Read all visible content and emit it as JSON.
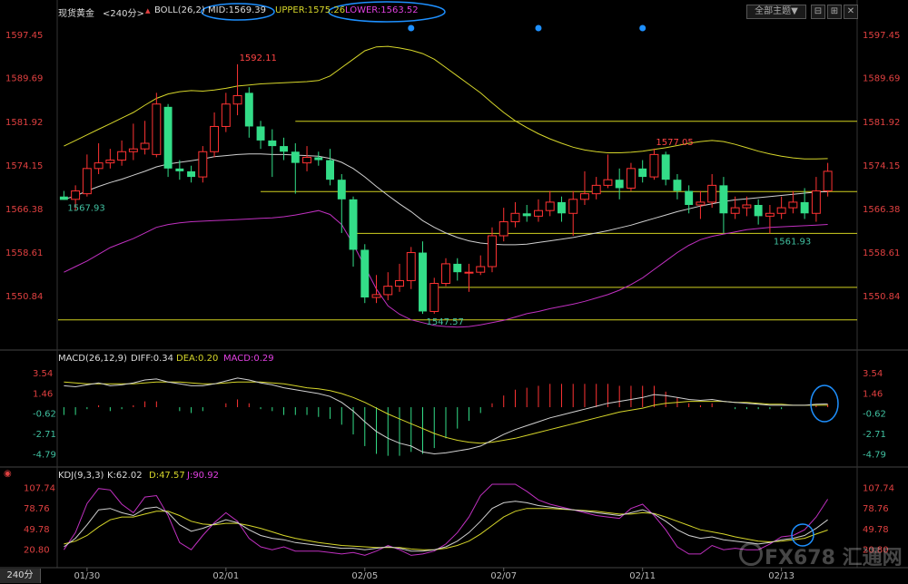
{
  "header": {
    "symbol": "现货黄金",
    "period": "<240分>",
    "boll": "BOLL(26,2)",
    "mid": "MID:1569.39",
    "upper": "UPPER:1575.26",
    "lower": "LOWER:1563.52",
    "theme_menu": "全部主题▼"
  },
  "macd_header": {
    "name": "MACD(26,12,9)",
    "diff": "DIFF:0.34",
    "dea": "DEA:0.20",
    "macd": "MACD:0.29"
  },
  "kdj_header": {
    "name": "KDJ(9,3,3)",
    "k": "K:62.02",
    "d": "D:47.57",
    "j": "J:90.92"
  },
  "period_tab": "240分",
  "watermark": "FX678 汇通网",
  "colors": {
    "up": "#ff3333",
    "down": "#33dd88",
    "mid": "#d0d0d0",
    "upper": "#d6d62a",
    "lower": "#c030c0",
    "hline": "#d0d020",
    "diff": "#d0d0d0",
    "dea": "#d6d62a",
    "j": "#c030c0",
    "axis_red": "#e04040",
    "axis_teal": "#40c0a0",
    "marker": "#1e90ff",
    "circle": "#1e90ff"
  },
  "chart_data": [
    {
      "type": "candlestick",
      "title": "现货黄金 240分",
      "ylim": [
        1545,
        1600
      ],
      "y_ticks": [
        1597.45,
        1589.69,
        1581.92,
        1574.15,
        1566.38,
        1558.61,
        1550.84
      ],
      "x_labels": [
        "01/30",
        "02/01",
        "02/05",
        "02/07",
        "02/11",
        "02/13"
      ],
      "x_label_index": [
        2,
        14,
        26,
        38,
        50,
        62
      ],
      "candles": [
        {
          "o": 1568.5,
          "c": 1567.9,
          "h": 1569.5,
          "l": 1567.9
        },
        {
          "o": 1568.0,
          "c": 1569.5,
          "h": 1570.5,
          "l": 1566.0
        },
        {
          "o": 1569.0,
          "c": 1573.5,
          "h": 1576.0,
          "l": 1568.5
        },
        {
          "o": 1573.5,
          "c": 1574.5,
          "h": 1578.0,
          "l": 1572.5
        },
        {
          "o": 1574.5,
          "c": 1575.0,
          "h": 1577.0,
          "l": 1573.5
        },
        {
          "o": 1575.0,
          "c": 1576.5,
          "h": 1578.5,
          "l": 1574.0
        },
        {
          "o": 1576.5,
          "c": 1577.0,
          "h": 1581.5,
          "l": 1575.0
        },
        {
          "o": 1577.0,
          "c": 1578.0,
          "h": 1582.0,
          "l": 1576.0
        },
        {
          "o": 1576.0,
          "c": 1585.0,
          "h": 1587.0,
          "l": 1575.5
        },
        {
          "o": 1584.5,
          "c": 1573.5,
          "h": 1585.0,
          "l": 1572.0
        },
        {
          "o": 1573.5,
          "c": 1573.0,
          "h": 1575.0,
          "l": 1571.5
        },
        {
          "o": 1573.0,
          "c": 1572.0,
          "h": 1574.0,
          "l": 1571.0
        },
        {
          "o": 1572.0,
          "c": 1576.5,
          "h": 1577.5,
          "l": 1571.0
        },
        {
          "o": 1576.5,
          "c": 1581.0,
          "h": 1583.5,
          "l": 1575.5
        },
        {
          "o": 1581.0,
          "c": 1585.0,
          "h": 1587.0,
          "l": 1580.0
        },
        {
          "o": 1585.0,
          "c": 1586.5,
          "h": 1592.1,
          "l": 1583.0
        },
        {
          "o": 1587.0,
          "c": 1581.0,
          "h": 1588.0,
          "l": 1579.0
        },
        {
          "o": 1581.0,
          "c": 1578.5,
          "h": 1582.0,
          "l": 1577.0
        },
        {
          "o": 1578.5,
          "c": 1577.5,
          "h": 1580.5,
          "l": 1572.0
        },
        {
          "o": 1577.5,
          "c": 1576.5,
          "h": 1579.0,
          "l": 1575.0
        },
        {
          "o": 1576.5,
          "c": 1574.5,
          "h": 1578.0,
          "l": 1569.0
        },
        {
          "o": 1574.5,
          "c": 1575.5,
          "h": 1577.5,
          "l": 1573.0
        },
        {
          "o": 1575.5,
          "c": 1575.0,
          "h": 1576.5,
          "l": 1574.0
        },
        {
          "o": 1575.0,
          "c": 1571.5,
          "h": 1577.0,
          "l": 1570.5
        },
        {
          "o": 1571.5,
          "c": 1568.0,
          "h": 1572.5,
          "l": 1562.0
        },
        {
          "o": 1568.0,
          "c": 1559.0,
          "h": 1568.5,
          "l": 1556.0
        },
        {
          "o": 1559.0,
          "c": 1550.5,
          "h": 1560.0,
          "l": 1549.5
        },
        {
          "o": 1550.5,
          "c": 1551.0,
          "h": 1554.5,
          "l": 1549.5
        },
        {
          "o": 1551.0,
          "c": 1552.5,
          "h": 1555.0,
          "l": 1550.0
        },
        {
          "o": 1552.5,
          "c": 1553.5,
          "h": 1556.5,
          "l": 1551.5
        },
        {
          "o": 1553.5,
          "c": 1558.5,
          "h": 1559.5,
          "l": 1552.0
        },
        {
          "o": 1558.5,
          "c": 1548.0,
          "h": 1560.5,
          "l": 1547.57
        },
        {
          "o": 1548.0,
          "c": 1553.0,
          "h": 1554.0,
          "l": 1547.6
        },
        {
          "o": 1553.0,
          "c": 1556.5,
          "h": 1557.5,
          "l": 1552.5
        },
        {
          "o": 1556.5,
          "c": 1555.0,
          "h": 1557.5,
          "l": 1553.5
        },
        {
          "o": 1555.0,
          "c": 1555.0,
          "h": 1556.5,
          "l": 1551.5
        },
        {
          "o": 1555.0,
          "c": 1556.0,
          "h": 1558.0,
          "l": 1554.5
        },
        {
          "o": 1556.0,
          "c": 1561.5,
          "h": 1563.0,
          "l": 1555.0
        },
        {
          "o": 1561.5,
          "c": 1564.0,
          "h": 1566.5,
          "l": 1560.5
        },
        {
          "o": 1564.0,
          "c": 1565.5,
          "h": 1567.5,
          "l": 1563.0
        },
        {
          "o": 1565.5,
          "c": 1565.0,
          "h": 1567.0,
          "l": 1564.0
        },
        {
          "o": 1565.0,
          "c": 1566.0,
          "h": 1568.0,
          "l": 1564.0
        },
        {
          "o": 1566.0,
          "c": 1567.5,
          "h": 1569.5,
          "l": 1565.0
        },
        {
          "o": 1567.5,
          "c": 1565.5,
          "h": 1568.5,
          "l": 1564.0
        },
        {
          "o": 1565.5,
          "c": 1568.0,
          "h": 1569.5,
          "l": 1561.5
        },
        {
          "o": 1568.0,
          "c": 1569.0,
          "h": 1573.0,
          "l": 1567.0
        },
        {
          "o": 1569.0,
          "c": 1570.5,
          "h": 1572.0,
          "l": 1568.0
        },
        {
          "o": 1570.5,
          "c": 1571.5,
          "h": 1576.0,
          "l": 1570.0
        },
        {
          "o": 1571.5,
          "c": 1570.0,
          "h": 1573.5,
          "l": 1568.0
        },
        {
          "o": 1570.0,
          "c": 1573.5,
          "h": 1574.5,
          "l": 1569.5
        },
        {
          "o": 1573.5,
          "c": 1572.0,
          "h": 1575.0,
          "l": 1571.0
        },
        {
          "o": 1572.0,
          "c": 1576.0,
          "h": 1577.05,
          "l": 1571.5
        },
        {
          "o": 1576.0,
          "c": 1571.5,
          "h": 1576.5,
          "l": 1570.5
        },
        {
          "o": 1571.5,
          "c": 1569.5,
          "h": 1572.5,
          "l": 1568.0
        },
        {
          "o": 1569.5,
          "c": 1567.0,
          "h": 1570.5,
          "l": 1565.5
        },
        {
          "o": 1567.0,
          "c": 1567.5,
          "h": 1569.5,
          "l": 1564.5
        },
        {
          "o": 1567.5,
          "c": 1570.5,
          "h": 1572.5,
          "l": 1566.5
        },
        {
          "o": 1570.5,
          "c": 1565.5,
          "h": 1572.0,
          "l": 1562.0
        },
        {
          "o": 1565.5,
          "c": 1566.5,
          "h": 1568.5,
          "l": 1564.5
        },
        {
          "o": 1566.5,
          "c": 1567.0,
          "h": 1568.5,
          "l": 1565.0
        },
        {
          "o": 1567.0,
          "c": 1565.0,
          "h": 1568.0,
          "l": 1563.5
        },
        {
          "o": 1565.0,
          "c": 1565.5,
          "h": 1567.0,
          "l": 1561.93
        },
        {
          "o": 1565.5,
          "c": 1566.5,
          "h": 1568.5,
          "l": 1564.5
        },
        {
          "o": 1566.5,
          "c": 1567.5,
          "h": 1569.5,
          "l": 1565.5
        },
        {
          "o": 1567.5,
          "c": 1565.5,
          "h": 1570.0,
          "l": 1564.5
        },
        {
          "o": 1565.5,
          "c": 1569.5,
          "h": 1572.0,
          "l": 1564.0
        },
        {
          "o": 1569.5,
          "c": 1573.0,
          "h": 1574.5,
          "l": 1568.5
        }
      ],
      "mid": [
        1568.0,
        1568.6,
        1569.5,
        1570.3,
        1571.0,
        1571.6,
        1572.3,
        1573.0,
        1573.8,
        1574.3,
        1574.6,
        1574.9,
        1575.2,
        1575.6,
        1575.8,
        1576.0,
        1576.1,
        1576.1,
        1576.0,
        1576.0,
        1575.9,
        1575.8,
        1575.7,
        1575.3,
        1574.6,
        1573.5,
        1572.0,
        1570.3,
        1568.7,
        1567.2,
        1565.8,
        1564.2,
        1563.0,
        1562.0,
        1561.2,
        1560.6,
        1560.2,
        1560.0,
        1559.9,
        1559.9,
        1560.0,
        1560.3,
        1560.6,
        1560.9,
        1561.2,
        1561.6,
        1562.0,
        1562.4,
        1562.9,
        1563.4,
        1564.0,
        1564.6,
        1565.2,
        1565.8,
        1566.3,
        1566.8,
        1567.2,
        1567.6,
        1567.9,
        1568.1,
        1568.3,
        1568.5,
        1568.7,
        1568.9,
        1569.1,
        1569.3,
        1569.39
      ],
      "upper": [
        1577.5,
        1578.5,
        1579.5,
        1580.5,
        1581.5,
        1582.5,
        1583.5,
        1584.8,
        1586.0,
        1586.8,
        1587.2,
        1587.4,
        1587.3,
        1587.5,
        1587.8,
        1588.2,
        1588.4,
        1588.6,
        1588.7,
        1588.8,
        1588.9,
        1589.0,
        1589.2,
        1590.0,
        1591.5,
        1593.0,
        1594.5,
        1595.2,
        1595.3,
        1595.0,
        1594.6,
        1594.0,
        1593.0,
        1591.5,
        1590.0,
        1588.5,
        1587.0,
        1585.2,
        1583.5,
        1582.0,
        1580.8,
        1579.7,
        1578.8,
        1578.0,
        1577.3,
        1576.8,
        1576.5,
        1576.3,
        1576.3,
        1576.4,
        1576.6,
        1576.9,
        1577.2,
        1577.6,
        1578.0,
        1578.3,
        1578.5,
        1578.3,
        1577.8,
        1577.2,
        1576.6,
        1576.1,
        1575.7,
        1575.4,
        1575.2,
        1575.2,
        1575.26
      ],
      "lower": [
        1555.0,
        1556.0,
        1557.0,
        1558.2,
        1559.4,
        1560.2,
        1561.0,
        1562.0,
        1563.0,
        1563.5,
        1563.8,
        1564.0,
        1564.1,
        1564.2,
        1564.3,
        1564.4,
        1564.5,
        1564.6,
        1564.7,
        1564.9,
        1565.2,
        1565.6,
        1566.0,
        1565.3,
        1563.5,
        1560.0,
        1556.0,
        1552.0,
        1549.0,
        1547.5,
        1546.5,
        1546.0,
        1545.5,
        1545.3,
        1545.2,
        1545.3,
        1545.6,
        1546.0,
        1546.4,
        1547.0,
        1547.6,
        1548.0,
        1548.5,
        1548.9,
        1549.3,
        1549.8,
        1550.4,
        1551.0,
        1551.8,
        1552.8,
        1554.0,
        1555.5,
        1557.0,
        1558.5,
        1559.8,
        1560.8,
        1561.4,
        1561.8,
        1562.2,
        1562.6,
        1562.8,
        1563.0,
        1563.1,
        1563.2,
        1563.3,
        1563.4,
        1563.52
      ],
      "hlines": [
        {
          "y": 1581.92,
          "x0": 20,
          "x1": 66
        },
        {
          "y": 1569.39,
          "x0": 17,
          "x1": 66
        },
        {
          "y": 1561.93,
          "x0": 25,
          "x1": 66
        },
        {
          "y": 1552.3,
          "x0": 32,
          "x1": 66
        },
        {
          "y": 1546.5,
          "x0": 0,
          "x1": 66
        }
      ],
      "annotations": [
        {
          "text": "1592.11",
          "index": 15,
          "value": 1592.11,
          "color": "#ff4444"
        },
        {
          "text": "1567.93",
          "index": 0,
          "value": 1567.93,
          "color": "#40c0a0"
        },
        {
          "text": "1547.57",
          "index": 31,
          "value": 1547.57,
          "color": "#40c0a0"
        },
        {
          "text": "1577.05",
          "index": 51,
          "value": 1577.05,
          "color": "#ff4444"
        },
        {
          "text": "1561.93",
          "index": 61,
          "value": 1561.93,
          "color": "#40c0a0"
        }
      ],
      "markers_index": [
        30,
        41,
        50
      ]
    },
    {
      "type": "macd",
      "ylim": [
        -5.5,
        4.2
      ],
      "y_ticks": [
        3.54,
        1.46,
        -0.62,
        -2.71,
        -4.79
      ],
      "diff": [
        2.2,
        2.1,
        2.3,
        2.5,
        2.2,
        2.3,
        2.5,
        2.8,
        2.9,
        2.6,
        2.4,
        2.2,
        2.2,
        2.4,
        2.7,
        3.0,
        2.8,
        2.5,
        2.3,
        2.0,
        1.8,
        1.6,
        1.4,
        1.1,
        0.5,
        -0.4,
        -1.5,
        -2.5,
        -3.2,
        -3.7,
        -4.0,
        -4.6,
        -4.8,
        -4.7,
        -4.5,
        -4.3,
        -4.0,
        -3.4,
        -2.8,
        -2.3,
        -1.9,
        -1.5,
        -1.1,
        -0.8,
        -0.5,
        -0.2,
        0.1,
        0.4,
        0.6,
        0.8,
        1.0,
        1.3,
        1.2,
        1.0,
        0.8,
        0.7,
        0.8,
        0.6,
        0.5,
        0.4,
        0.3,
        0.2,
        0.2,
        0.2,
        0.2,
        0.3,
        0.34
      ],
      "dea": [
        2.6,
        2.5,
        2.4,
        2.4,
        2.4,
        2.4,
        2.4,
        2.5,
        2.6,
        2.6,
        2.6,
        2.5,
        2.4,
        2.4,
        2.5,
        2.6,
        2.6,
        2.6,
        2.5,
        2.4,
        2.2,
        2.0,
        1.9,
        1.7,
        1.4,
        1.0,
        0.5,
        -0.1,
        -0.7,
        -1.2,
        -1.7,
        -2.2,
        -2.7,
        -3.1,
        -3.4,
        -3.6,
        -3.7,
        -3.6,
        -3.4,
        -3.2,
        -2.9,
        -2.6,
        -2.3,
        -2.0,
        -1.7,
        -1.4,
        -1.1,
        -0.8,
        -0.5,
        -0.3,
        -0.1,
        0.2,
        0.4,
        0.5,
        0.6,
        0.6,
        0.6,
        0.6,
        0.5,
        0.5,
        0.4,
        0.3,
        0.3,
        0.2,
        0.2,
        0.2,
        0.2
      ],
      "hist": [
        -0.8,
        -0.8,
        -0.2,
        0.2,
        -0.4,
        -0.2,
        0.2,
        0.6,
        0.6,
        0.0,
        -0.4,
        -0.6,
        -0.4,
        0.0,
        0.4,
        0.8,
        0.4,
        -0.2,
        -0.4,
        -0.8,
        -0.8,
        -0.8,
        -1.0,
        -1.2,
        -1.8,
        -2.8,
        -4.0,
        -4.8,
        -5.0,
        -5.0,
        -4.6,
        -4.8,
        -4.2,
        -3.2,
        -2.2,
        -1.4,
        -0.6,
        0.4,
        1.2,
        1.8,
        2.0,
        2.2,
        2.4,
        2.4,
        2.4,
        2.4,
        2.4,
        2.4,
        2.2,
        2.2,
        2.2,
        2.2,
        1.6,
        1.0,
        0.4,
        0.2,
        0.4,
        0.0,
        -0.2,
        -0.2,
        -0.2,
        -0.2,
        -0.2,
        0.0,
        0.0,
        0.2,
        0.29
      ]
    },
    {
      "type": "kdj",
      "ylim": [
        10,
        112
      ],
      "y_ticks": [
        107.74,
        78.76,
        49.78,
        20.8
      ],
      "k": [
        24,
        36,
        55,
        76,
        78,
        72,
        68,
        78,
        80,
        72,
        55,
        46,
        50,
        56,
        62,
        58,
        48,
        40,
        36,
        34,
        30,
        28,
        26,
        24,
        22,
        22,
        20,
        22,
        24,
        22,
        18,
        18,
        20,
        24,
        32,
        44,
        60,
        78,
        86,
        88,
        86,
        82,
        80,
        78,
        76,
        74,
        72,
        70,
        68,
        72,
        76,
        70,
        60,
        48,
        40,
        36,
        38,
        34,
        32,
        30,
        28,
        30,
        34,
        36,
        40,
        50,
        62.02
      ],
      "d": [
        28,
        32,
        40,
        52,
        62,
        66,
        66,
        70,
        74,
        74,
        68,
        60,
        56,
        55,
        57,
        57,
        54,
        50,
        45,
        40,
        36,
        33,
        30,
        28,
        26,
        25,
        24,
        23,
        23,
        23,
        21,
        20,
        20,
        22,
        26,
        32,
        42,
        54,
        66,
        74,
        78,
        78,
        78,
        77,
        76,
        75,
        74,
        72,
        70,
        70,
        72,
        71,
        66,
        60,
        54,
        48,
        45,
        42,
        38,
        35,
        32,
        31,
        32,
        34,
        36,
        42,
        47.57
      ],
      "j": [
        20,
        44,
        85,
        106,
        104,
        84,
        72,
        94,
        96,
        68,
        30,
        20,
        40,
        58,
        72,
        60,
        36,
        24,
        20,
        24,
        18,
        18,
        18,
        16,
        14,
        16,
        12,
        18,
        26,
        20,
        12,
        14,
        18,
        28,
        44,
        66,
        96,
        112,
        112,
        112,
        102,
        90,
        84,
        80,
        76,
        72,
        68,
        66,
        64,
        78,
        84,
        68,
        48,
        24,
        14,
        14,
        26,
        20,
        22,
        20,
        20,
        28,
        38,
        40,
        48,
        66,
        90.92
      ]
    }
  ]
}
